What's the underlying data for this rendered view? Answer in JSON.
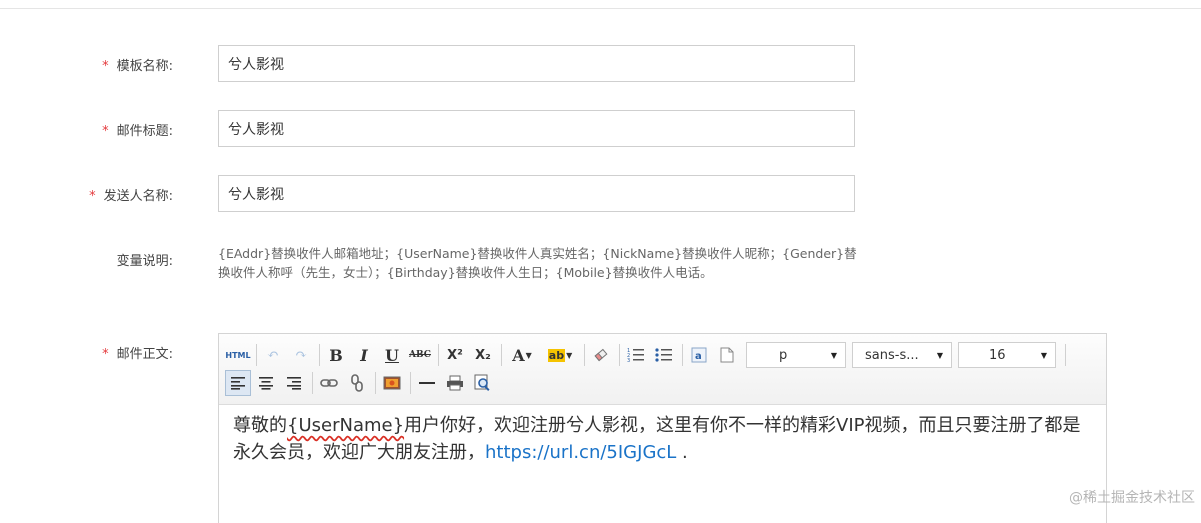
{
  "form": {
    "template_name": {
      "required_mark": "*",
      "label": "模板名称:",
      "value": "兮人影视"
    },
    "mail_title": {
      "required_mark": "*",
      "label": "邮件标题:",
      "value": "兮人影视"
    },
    "sender_name": {
      "required_mark": "*",
      "label": "发送人名称:",
      "value": "兮人影视"
    },
    "variables": {
      "label": "变量说明:",
      "text": "{EAddr}替换收件人邮箱地址；{UserName}替换收件人真实姓名；{NickName}替换收件人昵称；{Gender}替换收件人称呼（先生，女士）；{Birthday}替换收件人生日；{Mobile}替换收件人电话。"
    },
    "mail_body": {
      "required_mark": "*",
      "label": "邮件正文:"
    }
  },
  "editor": {
    "toolbar": {
      "html_label": "HTML",
      "bold": "B",
      "italic": "I",
      "underline": "U",
      "strike": "ABC",
      "superscript": "X²",
      "subscript": "X₂",
      "font_color": "A",
      "paragraph_select": "p",
      "font_family_select": "sans-s...",
      "font_size_select": "16"
    },
    "content": {
      "part1": "尊敬的",
      "variable": "{UserName}",
      "part2": "用户你好，欢迎注册兮人影视，这里有你不一样的精彩VIP视频，而且只要注册了都是永久会员，欢迎广大朋友注册，",
      "link": "https://url.cn/5IGJGcL",
      "part3": " ."
    }
  },
  "watermark": "@稀土掘金技术社区"
}
